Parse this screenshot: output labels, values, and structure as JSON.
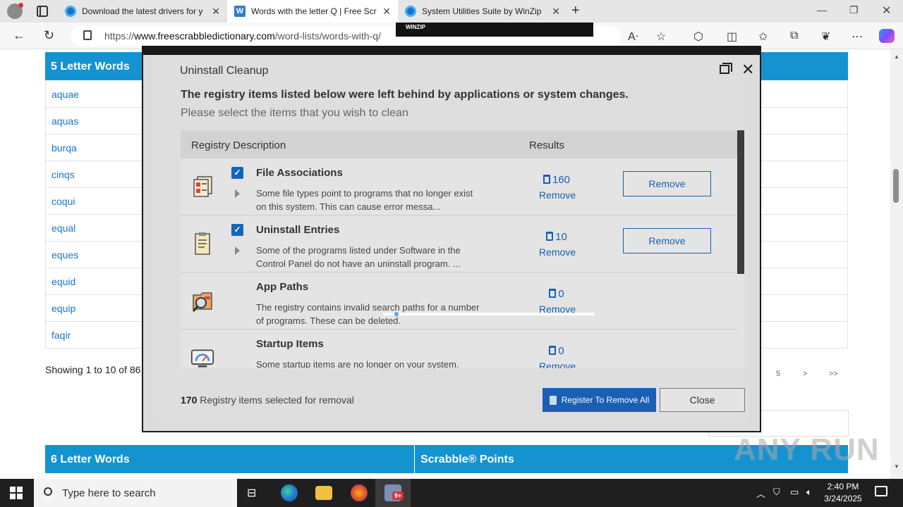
{
  "browser": {
    "tabs": [
      {
        "title": "Download the latest drivers for y"
      },
      {
        "title": "Words with the letter Q | Free Scr"
      },
      {
        "title": "System Utilities Suite by WinZip"
      }
    ],
    "url_prefix": "https://",
    "url_domain": "www.freescrabbledictionary.com",
    "url_path": "/word-lists/words-with-q/",
    "thumbnail_brand": "WINZIP"
  },
  "page": {
    "section1_title": "5 Letter Words",
    "words": [
      "aquae",
      "aquas",
      "burqa",
      "cinqs",
      "coqui",
      "equal",
      "eques",
      "equid",
      "equip",
      "faqir"
    ],
    "showing_text": "Showing 1 to 10 of 86",
    "pager": [
      "5",
      ">",
      ">>"
    ],
    "section2_title": "6 Letter Words",
    "section2_points": "Scrabble® Points"
  },
  "dialog": {
    "title": "Uninstall Cleanup",
    "heading": "The registry items listed below were left behind by applications or system changes.",
    "subheading": "Please select the items that you wish to clean",
    "col_description": "Registry Description",
    "col_results": "Results",
    "items": [
      {
        "name": "File Associations",
        "desc": "Some file types point to programs that no longer exist on this system. This can cause error messa...",
        "count": "160",
        "remove_link": "Remove",
        "remove_button": "Remove",
        "checked": true
      },
      {
        "name": "Uninstall Entries",
        "desc": "Some of the programs listed under Software in the Control Panel do not have an uninstall program. ...",
        "count": "10",
        "remove_link": "Remove",
        "remove_button": "Remove",
        "checked": true
      },
      {
        "name": "App Paths",
        "desc": "The registry contains invalid search paths for a number of programs. These can be deleted.",
        "count": "0",
        "remove_link": "Remove"
      },
      {
        "name": "Startup Items",
        "desc": "Some startup items are no longer on your system.",
        "count": "0",
        "remove_link": "Remove"
      }
    ],
    "selected_count": "170",
    "selected_text": "Registry items selected for removal",
    "primary_button": "Register To Remove All",
    "close_button": "Close"
  },
  "watermark": "ANY RUN",
  "taskbar": {
    "search_placeholder": "Type here to search",
    "badge": "9+",
    "time": "2:40 PM",
    "date": "3/24/2025"
  },
  "colors": {
    "site_header": "#1593d0",
    "dialog_accent": "#1a5fb4",
    "taskbar": "#1f1f1f"
  }
}
